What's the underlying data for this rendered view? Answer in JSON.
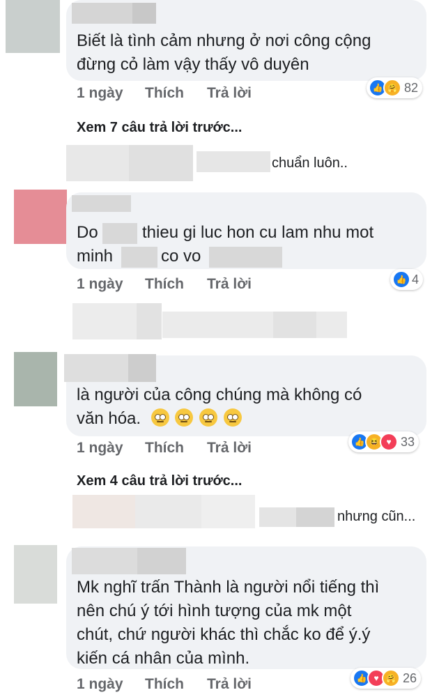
{
  "comments": [
    {
      "text_lines": [
        "Biết là tình cảm nhưng ở nơi công cộng",
        "đừng cỏ làm vậy thấy vô duyên"
      ],
      "time": "1 ngày",
      "like_label": "Thích",
      "reply_label": "Trả lời",
      "reactions": [
        "like",
        "care"
      ],
      "reaction_count": "82"
    },
    {
      "text_parts": {
        "p1": "Do",
        "p2": "thieu gi luc hon cu lam nhu mot",
        "p3": "minh",
        "p4": "co vo"
      },
      "time": "1 ngày",
      "like_label": "Thích",
      "reply_label": "Trả lời",
      "reactions": [
        "like"
      ],
      "reaction_count": "4"
    },
    {
      "text_lines": [
        "là người của công chúng mà không có",
        "văn hóa."
      ],
      "time": "1 ngày",
      "like_label": "Thích",
      "reply_label": "Trả lời",
      "reactions": [
        "like",
        "haha",
        "love"
      ],
      "reaction_count": "33"
    },
    {
      "text_lines": [
        "Mk nghĩ trấn Thành là người nổi tiếng thì",
        "nên chú ý tới hình tượng của mk một",
        "chút, chứ người khác thì chắc ko để ý.ý",
        "kiến cá nhân của mình."
      ],
      "time": "1 ngày",
      "like_label": "Thích",
      "reply_label": "Trả lời",
      "reactions": [
        "like",
        "love",
        "care"
      ],
      "reaction_count": "26"
    }
  ],
  "view_previous_1": "Xem 7 câu trả lời trước...",
  "view_previous_2": "Xem 4 câu trả lời trước...",
  "reply_preview_1": "chuẩn luôn..",
  "reply_preview_2": "nhưng cũn...",
  "colors": {
    "bubble": "#f0f2f5",
    "meta": "#65676b",
    "like": "#1877f2",
    "love": "#f33e58",
    "haha": "#f7b125",
    "care": "#f7b125"
  }
}
